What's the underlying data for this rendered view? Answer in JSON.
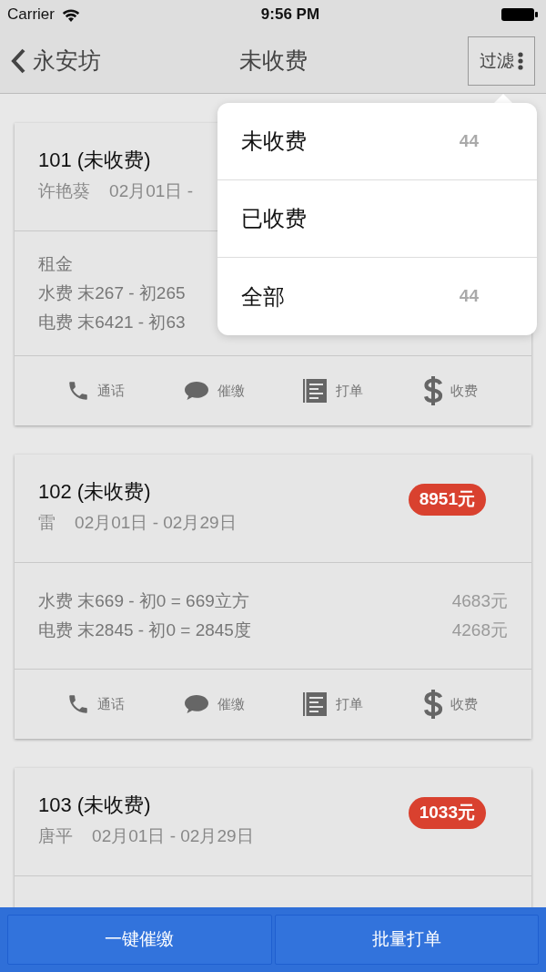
{
  "status_bar": {
    "carrier": "Carrier",
    "time": "9:56 PM"
  },
  "nav": {
    "back": "永安坊",
    "title": "未收费",
    "filter": "过滤"
  },
  "cards": [
    {
      "title": "101 (未收费)",
      "subtitle": "许艳葵    02月01日 -",
      "details": [
        {
          "text": "租金"
        },
        {
          "text": "水费 末267 - 初265"
        },
        {
          "text": "电费 末6421 - 初63"
        }
      ],
      "actions": [
        {
          "kind": "phone",
          "label": "通话"
        },
        {
          "kind": "chat",
          "label": "催缴"
        },
        {
          "kind": "list",
          "label": "打单"
        },
        {
          "kind": "dollar",
          "label": "收费"
        }
      ]
    },
    {
      "title": "102 (未收费)",
      "subtitle": "雷    02月01日 - 02月29日",
      "badge": "8951元",
      "details": [
        {
          "text": "水费 末669 - 初0 = 669立方",
          "amount": "4683元"
        },
        {
          "text": "电费 末2845 - 初0 = 2845度",
          "amount": "4268元"
        }
      ],
      "actions": [
        {
          "kind": "phone",
          "label": "通话"
        },
        {
          "kind": "chat",
          "label": "催缴"
        },
        {
          "kind": "list",
          "label": "打单"
        },
        {
          "kind": "dollar",
          "label": "收费"
        }
      ]
    },
    {
      "title": "103 (未收费)",
      "subtitle": "唐平    02月01日 - 02月29日",
      "badge": "1033元"
    }
  ],
  "dropdown": [
    {
      "label": "未收费",
      "count": "44"
    },
    {
      "label": "已收费"
    },
    {
      "label": "全部",
      "count": "44"
    }
  ],
  "bottom_buttons": [
    "一键催缴",
    "批量打单"
  ]
}
